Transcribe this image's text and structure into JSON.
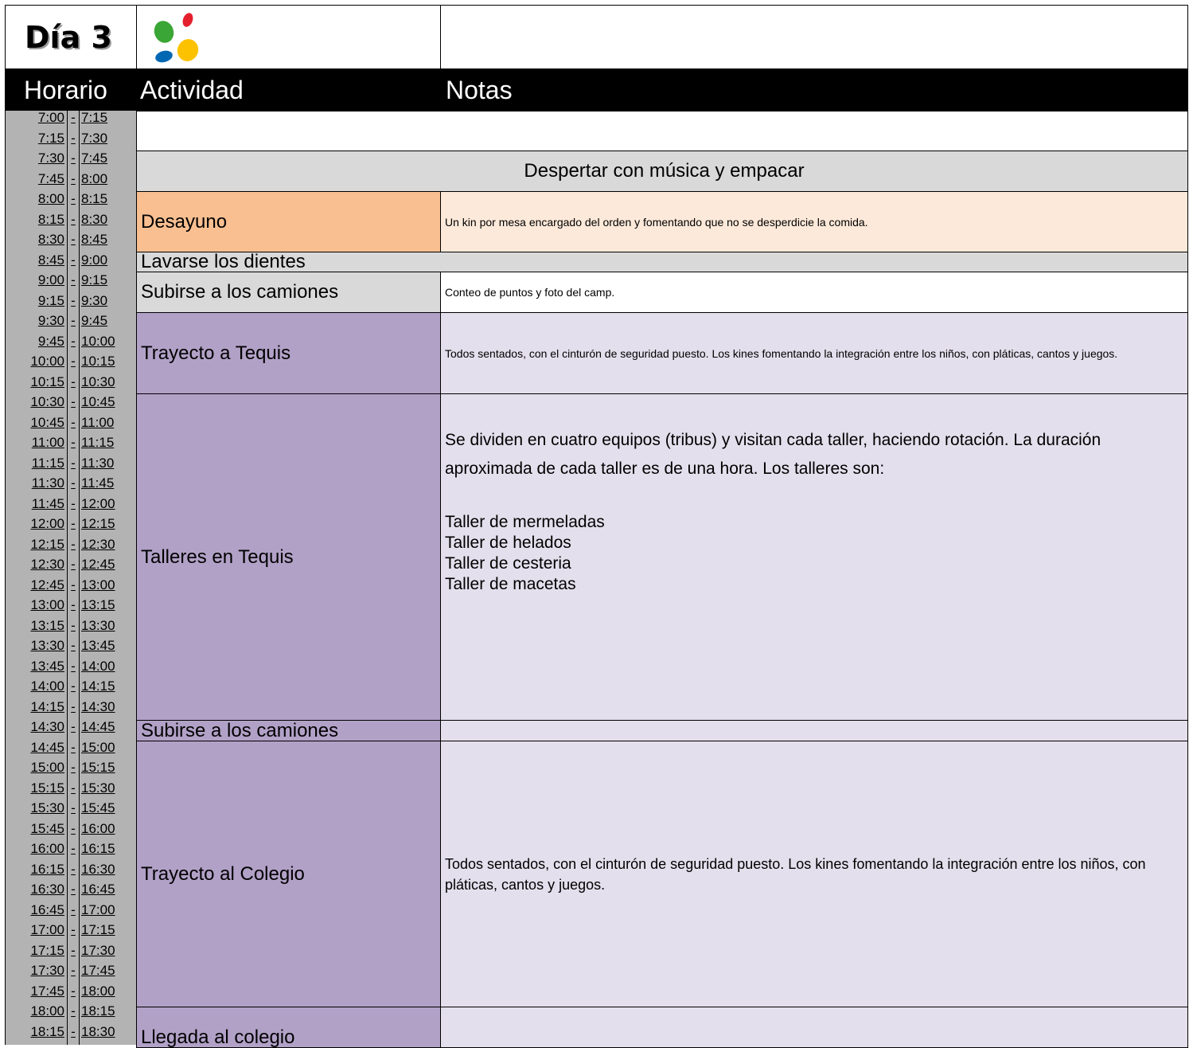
{
  "header": {
    "day_title": "Día 3",
    "col_time": "Horario",
    "col_activity": "Actividad",
    "col_notes": "Notas"
  },
  "colors": {
    "header_bg": "#000000",
    "time_bg": "#b3b3b3",
    "grey": "#d9d9d9",
    "orange": "#f9bf91",
    "orange_light": "#fde9d9",
    "purple": "#b2a1c7",
    "purple_light": "#e4dfec"
  },
  "slots": [
    [
      "7:00",
      "7:15"
    ],
    [
      "7:15",
      "7:30"
    ],
    [
      "7:30",
      "7:45"
    ],
    [
      "7:45",
      "8:00"
    ],
    [
      "8:00",
      "8:15"
    ],
    [
      "8:15",
      "8:30"
    ],
    [
      "8:30",
      "8:45"
    ],
    [
      "8:45",
      "9:00"
    ],
    [
      "9:00",
      "9:15"
    ],
    [
      "9:15",
      "9:30"
    ],
    [
      "9:30",
      "9:45"
    ],
    [
      "9:45",
      "10:00"
    ],
    [
      "10:00",
      "10:15"
    ],
    [
      "10:15",
      "10:30"
    ],
    [
      "10:30",
      "10:45"
    ],
    [
      "10:45",
      "11:00"
    ],
    [
      "11:00",
      "11:15"
    ],
    [
      "11:15",
      "11:30"
    ],
    [
      "11:30",
      "11:45"
    ],
    [
      "11:45",
      "12:00"
    ],
    [
      "12:00",
      "12:15"
    ],
    [
      "12:15",
      "12:30"
    ],
    [
      "12:30",
      "12:45"
    ],
    [
      "12:45",
      "13:00"
    ],
    [
      "13:00",
      "13:15"
    ],
    [
      "13:15",
      "13:30"
    ],
    [
      "13:30",
      "13:45"
    ],
    [
      "13:45",
      "14:00"
    ],
    [
      "14:00",
      "14:15"
    ],
    [
      "14:15",
      "14:30"
    ],
    [
      "14:30",
      "14:45"
    ],
    [
      "14:45",
      "15:00"
    ],
    [
      "15:00",
      "15:15"
    ],
    [
      "15:15",
      "15:30"
    ],
    [
      "15:30",
      "15:45"
    ],
    [
      "15:45",
      "16:00"
    ],
    [
      "16:00",
      "16:15"
    ],
    [
      "16:15",
      "16:30"
    ],
    [
      "16:30",
      "16:45"
    ],
    [
      "16:45",
      "17:00"
    ],
    [
      "17:00",
      "17:15"
    ],
    [
      "17:15",
      "17:30"
    ],
    [
      "17:30",
      "17:45"
    ],
    [
      "17:45",
      "18:00"
    ],
    [
      "18:00",
      "18:15"
    ],
    [
      "18:15",
      "18:30"
    ]
  ],
  "dash": "-",
  "activities": {
    "despertar": "Despertar con música y empacar",
    "desayuno": "Desayuno",
    "desayuno_note": "Un kin por mesa encargado del orden y fomentando que no se desperdicie la comida.",
    "dientes": "Lavarse los dientes",
    "camiones1": "Subirse a los camiones",
    "camiones1_note": "Conteo de puntos y foto del camp.",
    "trayecto_tequis": "Trayecto a Tequis",
    "trayecto_tequis_note": "Todos sentados, con el cinturón de seguridad puesto. Los kines fomentando la integración entre los niños, con pláticas, cantos y juegos.",
    "talleres": "Talleres en Tequis",
    "talleres_note": "Se dividen en cuatro equipos (tribus) y visitan cada taller, haciendo rotación. La duración aproximada de cada taller es de una hora. Los talleres son:",
    "talleres_list": [
      "Taller de mermeladas",
      "Taller de helados",
      "Taller de cesteria",
      "Taller de macetas"
    ],
    "camiones2": "Subirse a los camiones",
    "trayecto_colegio": "Trayecto al Colegio",
    "trayecto_colegio_note": "Todos sentados, con el cinturón de seguridad puesto. Los kines fomentando la integración entre los niños, con pláticas, cantos y juegos.",
    "llegada": "Llegada al colegio"
  }
}
